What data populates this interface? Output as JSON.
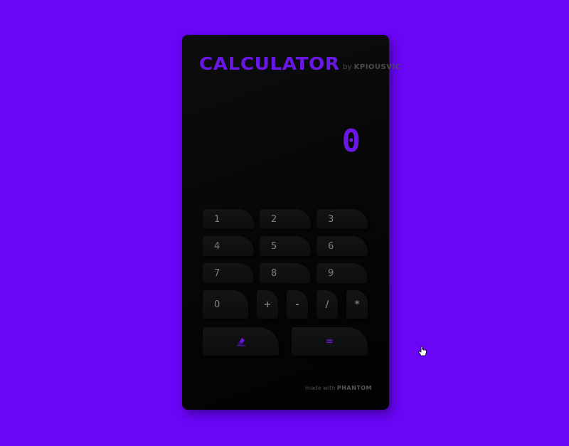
{
  "header": {
    "title": "CALCULATOR",
    "by_label": "by",
    "author": "KPIOUSVIC"
  },
  "display": {
    "value": "0"
  },
  "keys": {
    "k1": "1",
    "k2": "2",
    "k3": "3",
    "k4": "4",
    "k5": "5",
    "k6": "6",
    "k7": "7",
    "k8": "8",
    "k9": "9",
    "k0": "0",
    "plus": "+",
    "minus": "-",
    "divide": "/",
    "multiply": "*",
    "equals": "="
  },
  "footer": {
    "made_with": "made with",
    "brand": "PHANTOM"
  },
  "colors": {
    "background": "#6a05f6",
    "accent": "#6a17e6",
    "card": "#080808",
    "key_text": "#7d7d82"
  },
  "icons": {
    "clear": "eraser-icon",
    "cursor": "hand-cursor-icon"
  }
}
